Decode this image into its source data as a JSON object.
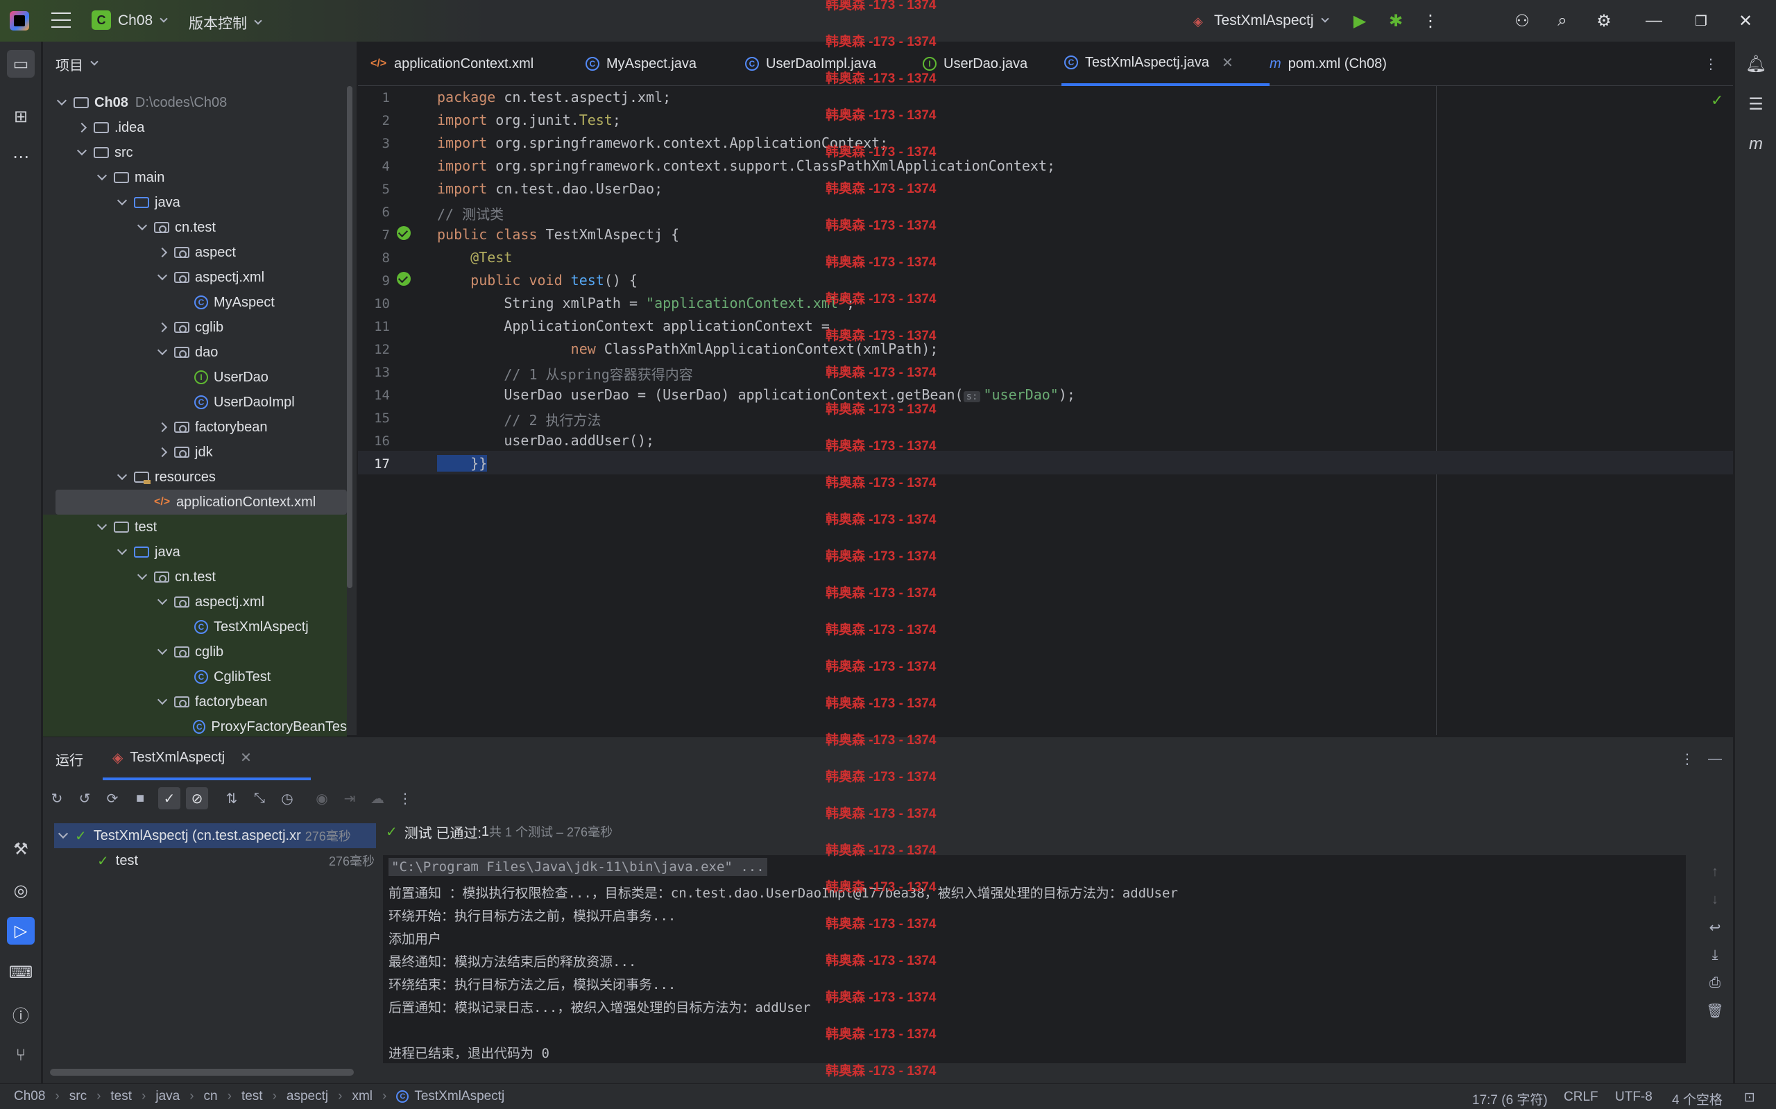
{
  "titlebar": {
    "project_badge": "C",
    "project_name": "Ch08",
    "vcs_label": "版本控制",
    "run_config": "TestXmlAspectj"
  },
  "project_panel": {
    "title": "项目",
    "root": {
      "name": "Ch08",
      "path": "D:\\codes\\Ch08"
    },
    "rows": [
      ".idea",
      "src",
      "main",
      "java",
      "cn.test",
      "aspect",
      "aspectj.xml",
      "MyAspect",
      "cglib",
      "dao",
      "UserDao",
      "UserDaoImpl",
      "factorybean",
      "jdk",
      "resources",
      "applicationContext.xml",
      "test",
      "java",
      "cn.test",
      "aspectj.xml",
      "TestXmlAspectj",
      "cglib",
      "CglibTest",
      "factorybean",
      "ProxyFactoryBeanTes"
    ]
  },
  "tabs": [
    {
      "label": "applicationContext.xml"
    },
    {
      "label": "MyAspect.java"
    },
    {
      "label": "UserDaoImpl.java"
    },
    {
      "label": "UserDao.java"
    },
    {
      "label": "TestXmlAspectj.java"
    },
    {
      "label": "pom.xml (Ch08)"
    }
  ],
  "editor": {
    "line_numbers": [
      "1",
      "2",
      "3",
      "4",
      "5",
      "6",
      "7",
      "8",
      "9",
      "10",
      "11",
      "12",
      "13",
      "14",
      "15",
      "16",
      "17"
    ],
    "code": {
      "l1_kw": "package",
      "l1_rest": " cn.test.aspectj.xml;",
      "l2_kw": "import",
      "l2_rest": " org.junit.",
      "l2_ann": "Test",
      "l2_end": ";",
      "l3_kw": "import",
      "l3_rest": " org.springframework.context.ApplicationContext;",
      "l4_kw": "import",
      "l4_rest": " org.springframework.context.support.ClassPathXmlApplicationContext;",
      "l5_kw": "import",
      "l5_rest": " cn.test.dao.UserDao;",
      "l6_cmt": "// 测试类",
      "l7_kw": "public class",
      "l7_rest": " TestXmlAspectj {",
      "l8_ann": "    @Test",
      "l9_kw": "    public void",
      "l9_fn": " test",
      "l9_rest": "() {",
      "l10_a": "        String xmlPath = ",
      "l10_str": "\"applicationContext.xml\"",
      "l10_end": ";",
      "l11": "        ApplicationContext applicationContext =",
      "l12_kw": "                new",
      "l12_rest": " ClassPathXmlApplicationContext(xmlPath);",
      "l13_cmt": "        // 1 从spring容器获得内容",
      "l14_a": "        UserDao userDao = (UserDao) applicationContext.getBean(",
      "l14_hint": "s:",
      "l14_str": "\"userDao\"",
      "l14_end": ");",
      "l15_cmt": "        // 2 执行方法",
      "l16": "        userDao.addUser();",
      "l17_a": "    }}"
    }
  },
  "run_panel": {
    "tab_run": "运行",
    "tab_test": "TestXmlAspectj",
    "tree_root": "TestXmlAspectj (cn.test.aspectj.xr",
    "tree_root_time": "276毫秒",
    "tree_child": "test",
    "tree_child_time": "276毫秒",
    "summary_prefix": "测试 已通过: ",
    "summary_count": "1",
    "summary_rest": "共 1 个测试 – 276毫秒",
    "console": [
      "\"C:\\Program Files\\Java\\jdk-11\\bin\\java.exe\" ...",
      "前置通知 ：模拟执行权限检查...，目标类是：cn.test.dao.UserDaoImpl@177bea38，被织入增强处理的目标方法为：addUser",
      "环绕开始：执行目标方法之前，模拟开启事务...",
      "添加用户",
      "最终通知：模拟方法结束后的释放资源...",
      "环绕结束：执行目标方法之后，模拟关闭事务...",
      "后置通知：模拟记录日志...，被织入增强处理的目标方法为：addUser",
      "",
      "进程已结束，退出代码为 0"
    ]
  },
  "watermark": "韩奥森 -173 - 1374",
  "statusbar": {
    "breadcrumbs": [
      "Ch08",
      "src",
      "test",
      "java",
      "cn",
      "test",
      "aspectj",
      "xml",
      "TestXmlAspectj"
    ],
    "position": "17:7 (6 字符)",
    "line_sep": "CRLF",
    "encoding": "UTF-8",
    "indent": "4 个空格"
  },
  "colors": {
    "accent": "#3574f0",
    "success": "#5fb832",
    "watermark": "#d03030",
    "background": "#1e1f22",
    "panel": "#2b2d30"
  }
}
